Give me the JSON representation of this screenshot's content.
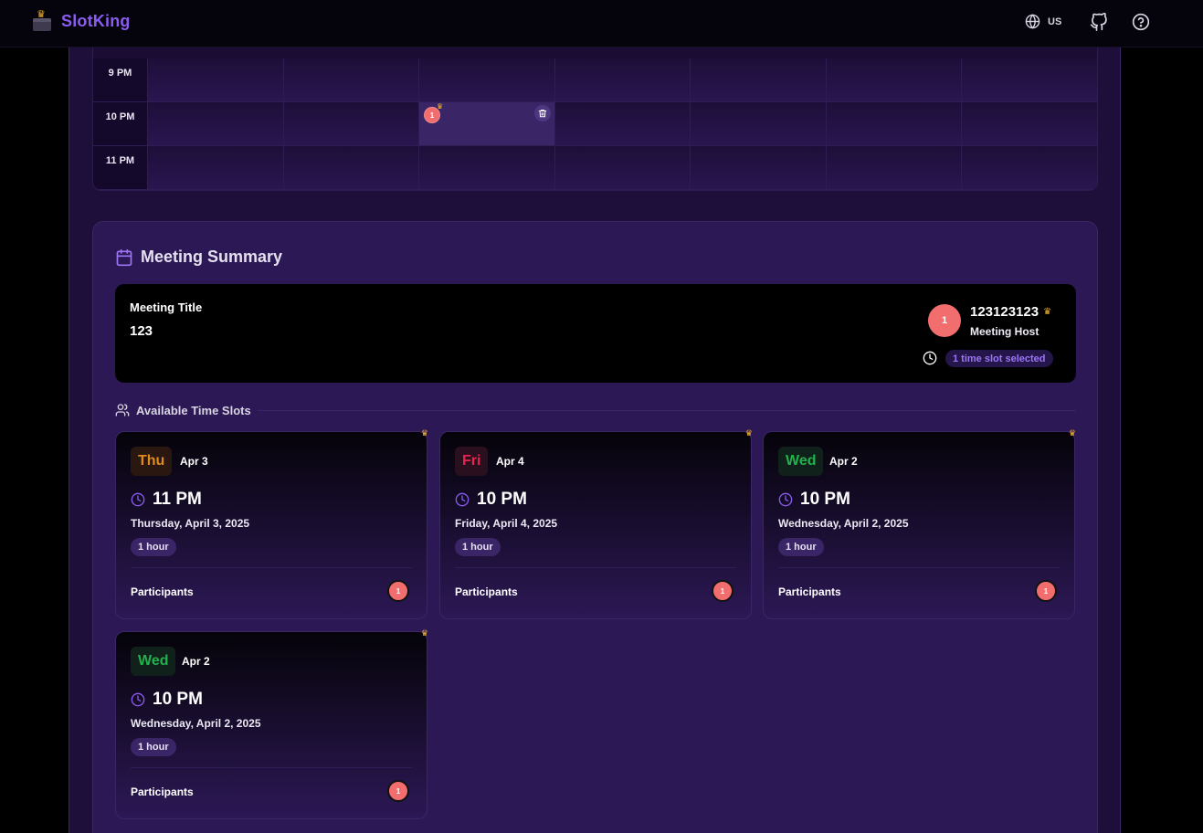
{
  "app": {
    "name": "SlotKing"
  },
  "nav": {
    "lang": "US",
    "icons": [
      "globe-icon",
      "github-icon",
      "help-icon"
    ]
  },
  "grid": {
    "rows": [
      {
        "time": "9 PM"
      },
      {
        "time": "10 PM"
      },
      {
        "time": "11 PM"
      }
    ],
    "selected_slot": {
      "badge": "1"
    }
  },
  "summary": {
    "title": "Meeting Summary",
    "meeting_title_label": "Meeting Title",
    "meeting_title_value": "123",
    "host_avatar": "1",
    "host_name": "123123123",
    "host_role": "Meeting Host",
    "selected_text": "1 time slot selected",
    "available_title": "Available Time Slots"
  },
  "slots": [
    {
      "day": "Thu",
      "date": "Apr 3",
      "time": "11 PM",
      "full_date": "Thursday, April 3, 2025",
      "duration": "1 hour",
      "participants_label": "Participants",
      "participant_avatar": "1",
      "day_color": "#e08a1e",
      "day_bg": "#2a1710"
    },
    {
      "day": "Fri",
      "date": "Apr 4",
      "time": "10 PM",
      "full_date": "Friday, April 4, 2025",
      "duration": "1 hour",
      "participants_label": "Participants",
      "participant_avatar": "1",
      "day_color": "#e8234f",
      "day_bg": "#2a0f1f"
    },
    {
      "day": "Wed",
      "date": "Apr 2",
      "time": "10 PM",
      "full_date": "Wednesday, April 2, 2025",
      "duration": "1 hour",
      "participants_label": "Participants",
      "participant_avatar": "1",
      "day_color": "#22b24c",
      "day_bg": "#10201a"
    },
    {
      "day": "Wed",
      "date": "Apr 2",
      "time": "10 PM",
      "full_date": "Wednesday, April 2, 2025",
      "duration": "1 hour",
      "participants_label": "Participants",
      "participant_avatar": "1",
      "day_color": "#22b24c",
      "day_bg": "#10201a"
    }
  ]
}
